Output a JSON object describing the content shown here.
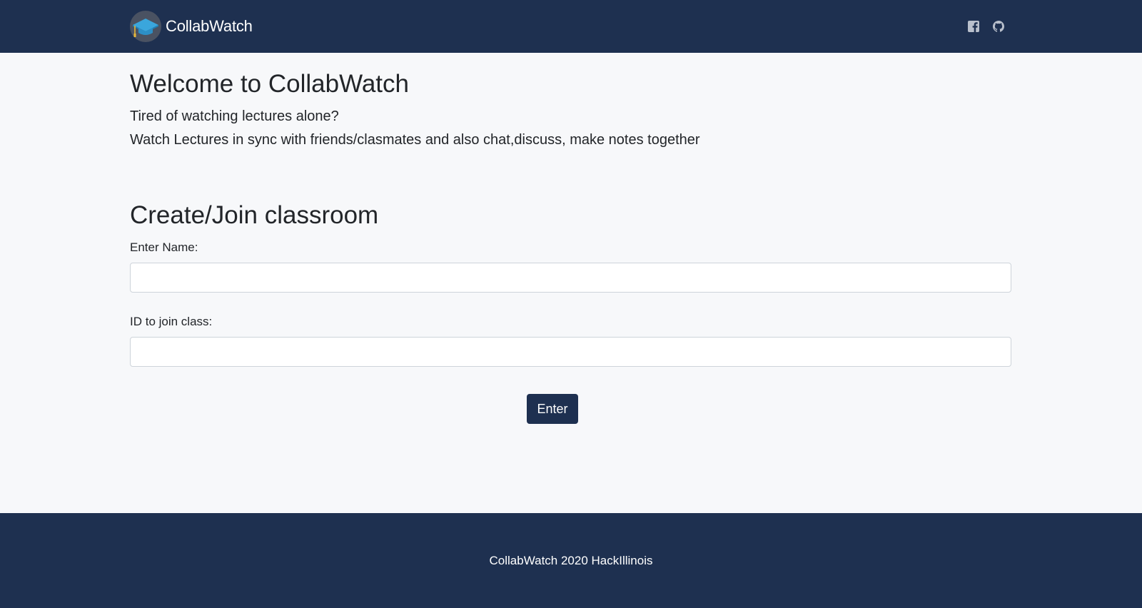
{
  "navbar": {
    "brand_name": "CollabWatch",
    "logo_icon": "graduation-cap-icon",
    "social_icons": [
      "facebook-icon",
      "github-icon"
    ]
  },
  "welcome": {
    "title": "Welcome to CollabWatch",
    "lead_line_1": "Tired of watching lectures alone?",
    "lead_line_2": "Watch Lectures in sync with friends/clasmates and also chat,discuss, make notes together"
  },
  "form": {
    "title": "Create/Join classroom",
    "name_label": "Enter Name:",
    "name_value": "",
    "name_placeholder": "",
    "id_label": "ID to join class:",
    "id_value": "",
    "id_placeholder": "",
    "submit_label": "Enter"
  },
  "footer": {
    "text": "CollabWatch 2020 HackIllinois"
  },
  "colors": {
    "navbar_bg": "#1e3050",
    "page_bg": "#f7f8fa",
    "button_bg": "#1e3050",
    "icon_color": "#b9c0cc"
  }
}
